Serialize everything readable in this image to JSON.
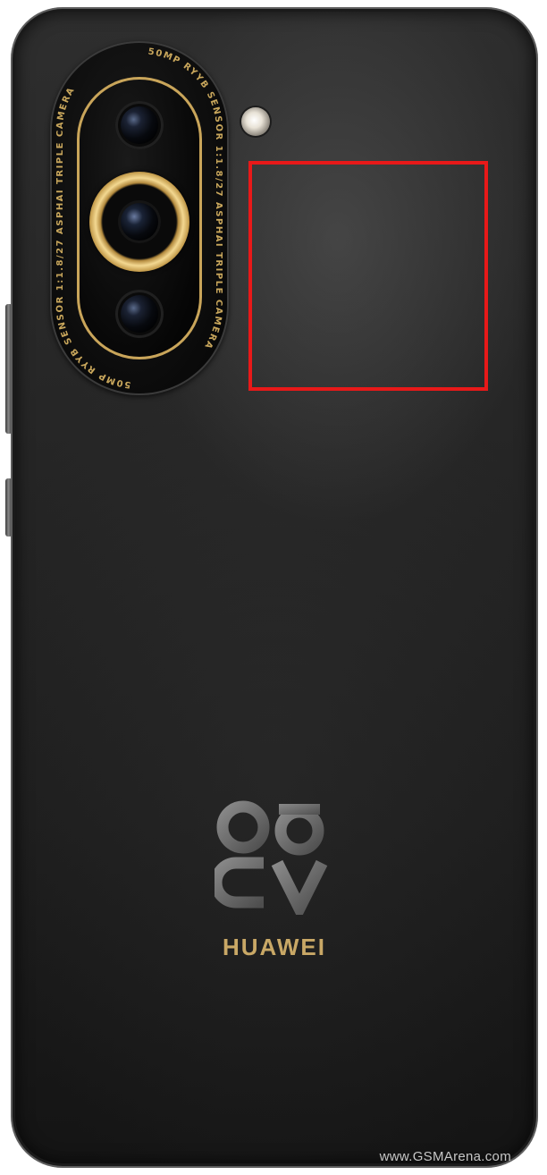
{
  "camera": {
    "ring_text_right": "50MP RYYB SENSOR 1:1.8/27 ASPH.",
    "ring_text_left": "AI TRIPLE CAMERA"
  },
  "branding": {
    "logo_name": "nova-logo-icon",
    "name": "HUAWEI"
  },
  "watermark": "www.GSMArena.com",
  "colors": {
    "body": "#242424",
    "accent_gold": "#c9a55a",
    "highlight": "#e81919"
  }
}
